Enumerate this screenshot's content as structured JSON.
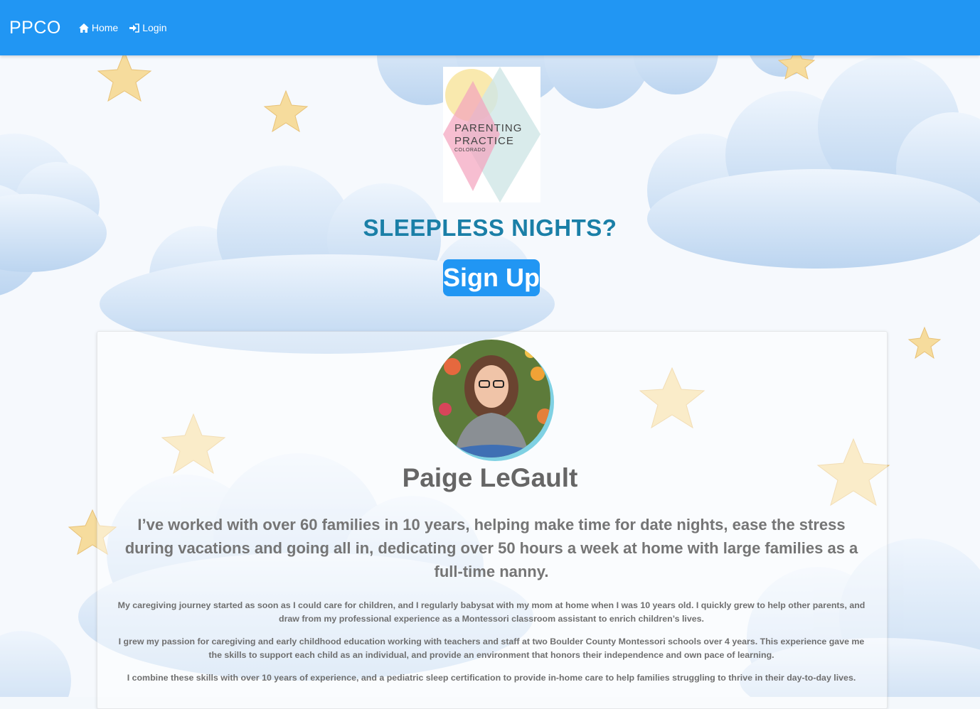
{
  "navbar": {
    "brand": "PPCO",
    "links": [
      {
        "label": "Home",
        "icon": "home-icon"
      },
      {
        "label": "Login",
        "icon": "sign-in-icon"
      }
    ]
  },
  "logo": {
    "line1": "PARENTING",
    "line2": "PRACTICE",
    "line3": "COLORADO"
  },
  "hero": {
    "headline": "SLEEPLESS NIGHTS?",
    "cta_label": "Sign Up"
  },
  "profile": {
    "name": "Paige LeGault",
    "lead": "I’ve worked with over 60 families in 10 years, helping make time for date nights, ease the stress during vacations and going all in, dedicating over 50 hours a week at home with large families as a full-time nanny.",
    "paragraphs": [
      "My caregiving journey started as soon as I could care for children, and I regularly babysat with my mom at home when I was 10 years old. I quickly grew to help other parents, and draw from my professional experience as a Montessori classroom assistant to enrich children’s lives.",
      "I grew my passion for caregiving and early childhood education working with teachers and staff at two Boulder County Montessori schools over 4 years. This experience gave me the skills to support each child as an individual, and provide an environment that honors their independence and own pace of learning.",
      "I combine these skills with over 10 years of experience, and a pediatric sleep certification to provide in-home care to help families struggling to thrive in their day-to-day lives."
    ]
  },
  "colors": {
    "primary": "#2196f3",
    "headline": "#1a7fa7",
    "text": "#757575"
  }
}
